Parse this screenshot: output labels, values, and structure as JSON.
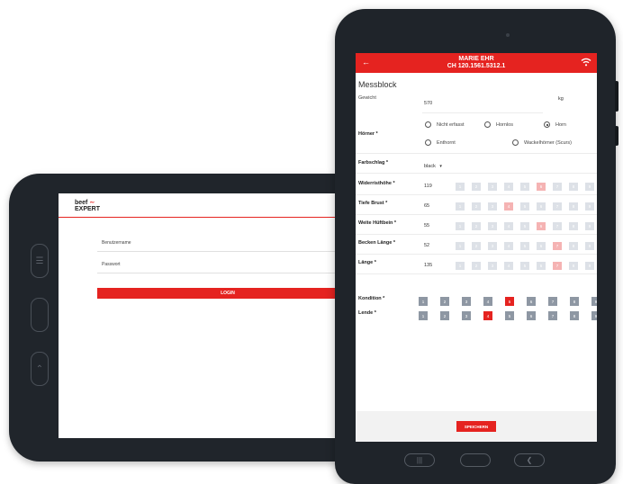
{
  "login": {
    "logo_line1": "beef",
    "logo_line2": "EXPERT",
    "username_label": "Benutzername",
    "password_label": "Passwort",
    "login_button": "LOGIN"
  },
  "header": {
    "name": "MARIE EHR",
    "id": "CH 120.1561.5312.1"
  },
  "form": {
    "section_title": "Messblock",
    "weight": {
      "label": "Gewicht",
      "value": "570",
      "unit": "kg"
    },
    "horns": {
      "label": "Hörner *",
      "options": [
        "Nicht erfasst",
        "Hornlos",
        "Horn",
        "Enthornt",
        "Wackelhörner (Scurs)"
      ],
      "selected": "Horn"
    },
    "color": {
      "label": "Farbschlag *",
      "value": "black"
    },
    "measurements": [
      {
        "label": "Widerristhöhe *",
        "value": "119",
        "selected": 6
      },
      {
        "label": "Tiefe Brust *",
        "value": "65",
        "selected": 4
      },
      {
        "label": "Weite Hüftbein *",
        "value": "55",
        "selected": 6
      },
      {
        "label": "Becken Länge *",
        "value": "52",
        "selected": 7
      },
      {
        "label": "Länge *",
        "value": "135",
        "selected": 7
      }
    ],
    "scale": [
      "1",
      "2",
      "3",
      "4",
      "5",
      "6",
      "7",
      "8",
      "9"
    ],
    "kondition": {
      "label": "Kondition *",
      "selected": 5
    },
    "lende": {
      "label": "Lende *",
      "selected": 4
    },
    "save_button": "SPEICHERN"
  },
  "colors": {
    "brand_red": "#e52320",
    "device_frame": "#1f242a",
    "scale_active_gray": "#8e97a3"
  }
}
